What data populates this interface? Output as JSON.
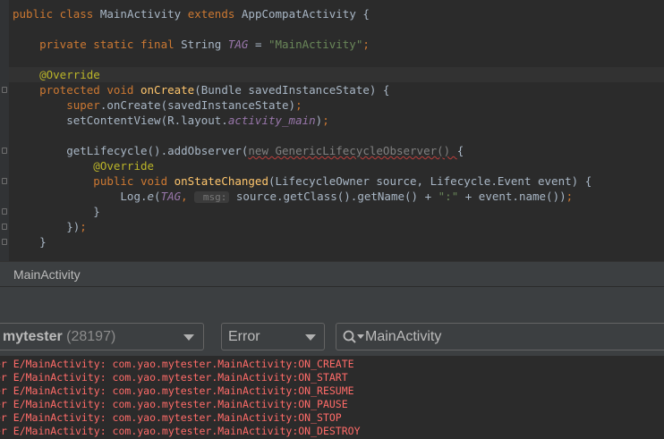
{
  "editor": {
    "lines": [
      [
        {
          "t": "public class ",
          "c": "kw"
        },
        {
          "t": "MainActivity ",
          "c": ""
        },
        {
          "t": "extends ",
          "c": "kw"
        },
        {
          "t": "AppCompatActivity {",
          "c": ""
        }
      ],
      [],
      [
        {
          "t": "    private static final ",
          "c": "kw"
        },
        {
          "t": "String ",
          "c": ""
        },
        {
          "t": "TAG",
          "c": "fld"
        },
        {
          "t": " = ",
          "c": ""
        },
        {
          "t": "\"MainActivity\"",
          "c": "str"
        },
        {
          "t": ";",
          "c": "kw"
        }
      ],
      [],
      [
        {
          "t": "    @Override",
          "c": "ann"
        }
      ],
      [
        {
          "t": "    protected void ",
          "c": "kw"
        },
        {
          "t": "onCreate",
          "c": "fn"
        },
        {
          "t": "(Bundle savedInstanceState) {",
          "c": ""
        }
      ],
      [
        {
          "t": "        super",
          "c": "kw"
        },
        {
          "t": ".onCreate(savedInstanceState)",
          "c": ""
        },
        {
          "t": ";",
          "c": "kw"
        }
      ],
      [
        {
          "t": "        setContentView(R.layout.",
          "c": ""
        },
        {
          "t": "activity_main",
          "c": "fld"
        },
        {
          "t": ")",
          "c": ""
        },
        {
          "t": ";",
          "c": "kw"
        }
      ],
      [],
      [
        {
          "t": "        getLifecycle().addObserver(",
          "c": ""
        },
        {
          "t": "new GenericLifecycleObserver() ",
          "c": "gray wavy"
        },
        {
          "t": "{",
          "c": ""
        }
      ],
      [
        {
          "t": "            @Override",
          "c": "ann"
        }
      ],
      [
        {
          "t": "            public void ",
          "c": "kw"
        },
        {
          "t": "onStateChanged",
          "c": "fn"
        },
        {
          "t": "(LifecycleOwner source, Lifecycle.Event event) {",
          "c": ""
        }
      ],
      [
        {
          "t": "                Log.",
          "c": ""
        },
        {
          "t": "e",
          "c": "it"
        },
        {
          "t": "(",
          "c": ""
        },
        {
          "t": "TAG",
          "c": "fld"
        },
        {
          "t": ", ",
          "c": "kw"
        },
        {
          "t": " msg:",
          "c": "hint"
        },
        {
          "t": " source.getClass().getName() + ",
          "c": ""
        },
        {
          "t": "\":\"",
          "c": "str"
        },
        {
          "t": " + event.name())",
          "c": ""
        },
        {
          "t": ";",
          "c": "kw"
        }
      ],
      [
        {
          "t": "            }",
          "c": ""
        }
      ],
      [
        {
          "t": "        })",
          "c": ""
        },
        {
          "t": ";",
          "c": "kw"
        }
      ],
      [
        {
          "t": "    }",
          "c": ""
        }
      ]
    ]
  },
  "breadcrumb": "MainActivity",
  "logcat": {
    "process_name": "mytester",
    "process_pid": "(28197)",
    "level": "Error",
    "search_value": "MainActivity",
    "lines": [
      "er E/MainActivity: com.yao.mytester.MainActivity:ON_CREATE",
      "er E/MainActivity: com.yao.mytester.MainActivity:ON_START",
      "er E/MainActivity: com.yao.mytester.MainActivity:ON_RESUME",
      "er E/MainActivity: com.yao.mytester.MainActivity:ON_PAUSE",
      "er E/MainActivity: com.yao.mytester.MainActivity:ON_STOP",
      "er E/MainActivity: com.yao.mytester.MainActivity:ON_DESTROY"
    ]
  },
  "icons": {
    "search": "search-icon",
    "dropdown": "chevron-down-icon"
  }
}
